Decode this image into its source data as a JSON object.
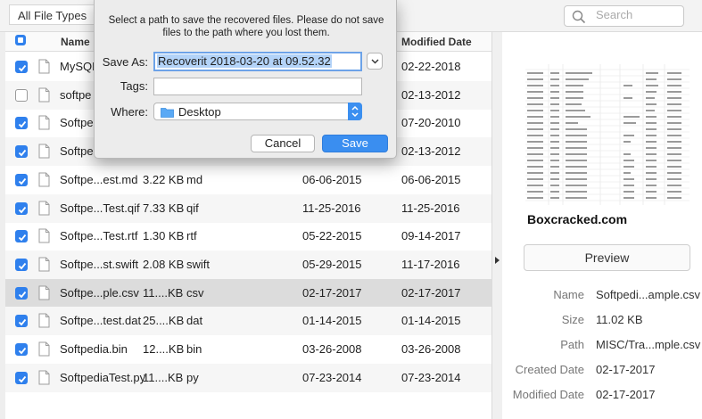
{
  "toolbar": {
    "filter_label": "All File Types",
    "search_placeholder": "Search"
  },
  "table": {
    "columns": {
      "name": "Name",
      "modified": "Modified Date"
    },
    "rows": [
      {
        "checked": true,
        "name": "MySQL",
        "size": "",
        "type": "",
        "created": "",
        "modified": "02-22-2018"
      },
      {
        "checked": false,
        "name": "softpe",
        "size": "",
        "type": "",
        "created": "",
        "modified": "02-13-2012"
      },
      {
        "checked": true,
        "name": "Softpe.",
        "size": "",
        "type": "",
        "created": "",
        "modified": "07-20-2010"
      },
      {
        "checked": true,
        "name": "Softpe.",
        "size": "",
        "type": "",
        "created": "",
        "modified": "02-13-2012"
      },
      {
        "checked": true,
        "name": "Softpe...est.md",
        "size": "3.22 KB",
        "type": "md",
        "created": "06-06-2015",
        "modified": "06-06-2015"
      },
      {
        "checked": true,
        "name": "Softpe...Test.qif",
        "size": "7.33 KB",
        "type": "qif",
        "created": "11-25-2016",
        "modified": "11-25-2016"
      },
      {
        "checked": true,
        "name": "Softpe...Test.rtf",
        "size": "1.30 KB",
        "type": "rtf",
        "created": "05-22-2015",
        "modified": "09-14-2017"
      },
      {
        "checked": true,
        "name": "Softpe...st.swift",
        "size": "2.08 KB",
        "type": "swift",
        "created": "05-29-2015",
        "modified": "11-17-2016"
      },
      {
        "checked": true,
        "name": "Softpe...ple.csv",
        "size": "11....KB",
        "type": "csv",
        "created": "02-17-2017",
        "modified": "02-17-2017"
      },
      {
        "checked": true,
        "name": "Softpe...test.dat",
        "size": "25....KB",
        "type": "dat",
        "created": "01-14-2015",
        "modified": "01-14-2015"
      },
      {
        "checked": true,
        "name": "Softpedia.bin",
        "size": "12....KB",
        "type": "bin",
        "created": "03-26-2008",
        "modified": "03-26-2008"
      },
      {
        "checked": true,
        "name": "SoftpediaTest.py",
        "size": "11....KB",
        "type": "py",
        "created": "07-23-2014",
        "modified": "07-23-2014"
      }
    ],
    "selected_row": 8
  },
  "dialog": {
    "message": "Select a path to save the recovered files. Please do not save files to the path where you lost them.",
    "save_as_label": "Save As:",
    "save_as_value": "Recoverit 2018-03-20 at 09.52.32",
    "tags_label": "Tags:",
    "tags_value": "",
    "where_label": "Where:",
    "where_value": "Desktop",
    "cancel_label": "Cancel",
    "save_label": "Save"
  },
  "preview": {
    "watermark": "Boxcracked.com",
    "button_label": "Preview",
    "details": [
      {
        "key": "Name",
        "value": "Softpedi...ample.csv"
      },
      {
        "key": "Size",
        "value": "11.02 KB"
      },
      {
        "key": "Path",
        "value": "MISC/Tra...mple.csv"
      },
      {
        "key": "Created Date",
        "value": "02-17-2017"
      },
      {
        "key": "Modified Date",
        "value": "02-17-2017"
      }
    ]
  },
  "colors": {
    "accent": "#2f80ed",
    "selected_row": "#dcdcdc"
  },
  "icons": [
    "search-icon",
    "checkbox-icon",
    "document-icon",
    "folder-icon",
    "chevron-down-icon",
    "stepper-icon",
    "expand-arrow-icon"
  ]
}
